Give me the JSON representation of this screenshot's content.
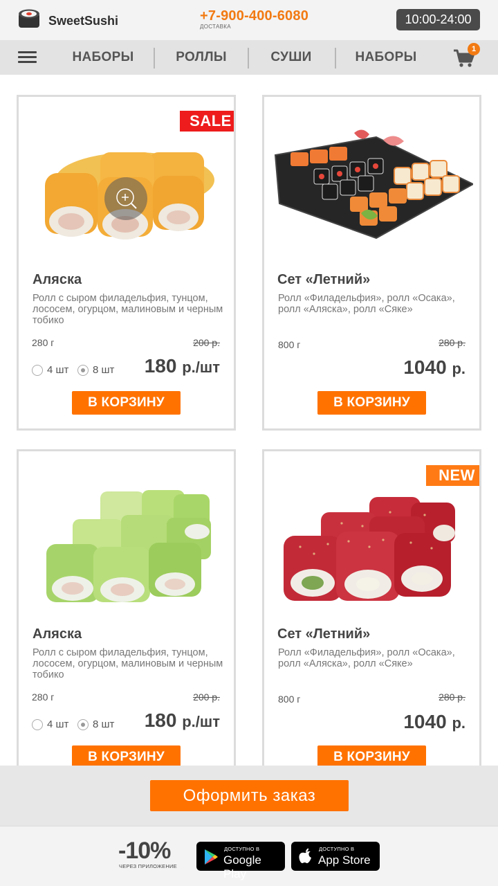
{
  "header": {
    "brand": "SweetSushi",
    "phone": "+7-900-400-6080",
    "phone_note": "ДОСТАВКА",
    "hours": "10:00-24:00"
  },
  "nav": {
    "items": [
      "НАБОРЫ",
      "РОЛЛЫ",
      "СУШИ",
      "НАБОРЫ"
    ],
    "cart_count": "1"
  },
  "products": [
    {
      "badge": "SALE",
      "title": "Аляска",
      "description": "Ролл с сыром филадельфия, тунцом, лососем, огурцом, малиновым и черным тобико",
      "weight": "280 г",
      "old_price": "200 р.",
      "price": "180",
      "price_unit": "р./шт",
      "options": [
        "4 шт",
        "8 шт"
      ],
      "selected_option": "8 шт",
      "button": "В КОРЗИНУ"
    },
    {
      "title": "Сет «Летний»",
      "description": "Ролл «Филадельфия», ролл «Осака», ролл «Аляска», ролл «Сяке»",
      "weight": "800 г",
      "old_price": "280 р.",
      "price": "1040",
      "price_unit": "р.",
      "button": "В КОРЗИНУ"
    },
    {
      "title": "Аляска",
      "description": "Ролл с сыром филадельфия, тунцом, лососем, огурцом, малиновым и черным тобико",
      "weight": "280 г",
      "old_price": "200 р.",
      "price": "180",
      "price_unit": "р./шт",
      "options": [
        "4 шт",
        "8 шт"
      ],
      "selected_option": "8 шт",
      "button": "В КОРЗИНУ"
    },
    {
      "badge": "NEW",
      "title": "Сет «Летний»",
      "description": "Ролл «Филадельфия», ролл «Осака», ролл «Аляска», ролл «Сяке»",
      "weight": "800 г",
      "old_price": "280 р.",
      "price": "1040",
      "price_unit": "р.",
      "button": "В КОРЗИНУ"
    }
  ],
  "order": {
    "button": "Оформить заказ"
  },
  "footer": {
    "discount": "-10%",
    "discount_note": "ЧЕРЕЗ ПРИЛОЖЕНИЕ",
    "google_play_small": "ДОСТУПНО В",
    "google_play_big": "Google Play",
    "app_store_small": "ДОСТУПНО В",
    "app_store_big": "App Store"
  },
  "colors": {
    "accent": "#ff7200",
    "sale": "#ee1c1c",
    "new": "#ff7a14",
    "dark_badge": "#4a4a4a"
  },
  "icons": [
    "sushi-logo-icon",
    "hamburger-menu-icon",
    "cart-icon",
    "zoom-icon",
    "google-play-icon",
    "apple-icon"
  ]
}
